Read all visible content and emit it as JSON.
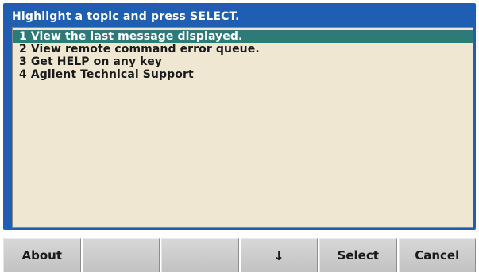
{
  "dialog": {
    "title": "Highlight a topic and press SELECT.",
    "selected_index": 0,
    "topics": [
      {
        "label": "1 View the last message displayed."
      },
      {
        "label": "2 View remote command error queue."
      },
      {
        "label": "3 Get HELP on any key"
      },
      {
        "label": "4 Agilent Technical Support"
      }
    ]
  },
  "softkeys": {
    "about": "About",
    "blank1": "",
    "blank2": "",
    "down_icon": "down-arrow-icon",
    "down_glyph": "↓",
    "select": "Select",
    "cancel": "Cancel"
  },
  "colors": {
    "title_bar": "#1f5fb3",
    "panel_bg": "#f0e7d2",
    "selection_bg": "#2e7a78",
    "softkey_bg": "#cfcfcf"
  }
}
